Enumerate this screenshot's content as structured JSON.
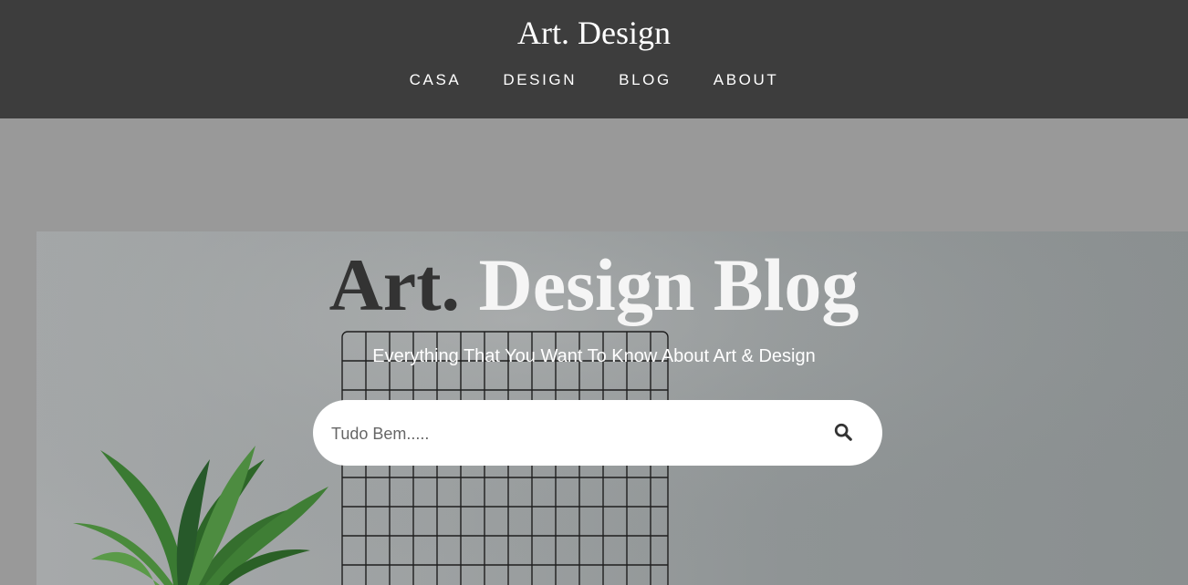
{
  "header": {
    "site_title": "Art. Design",
    "background_color": "#3d3d3d",
    "nav": [
      {
        "label": "CASA"
      },
      {
        "label": "DESIGN"
      },
      {
        "label": "BLOG"
      },
      {
        "label": "ABOUT"
      }
    ]
  },
  "hero": {
    "title_dark": "Art.",
    "title_light": "Design Blog",
    "subtitle": "Everything That You Want To Know About Art & Design",
    "image_content": "grid panel and potted plant against grey wall"
  },
  "search": {
    "placeholder": "Tudo Bem.....",
    "value": "",
    "icon": "search-icon"
  },
  "colors": {
    "page_background": "#999999",
    "title_dark": "#333333",
    "title_light": "#f5f5f5",
    "search_background": "#ffffff"
  }
}
